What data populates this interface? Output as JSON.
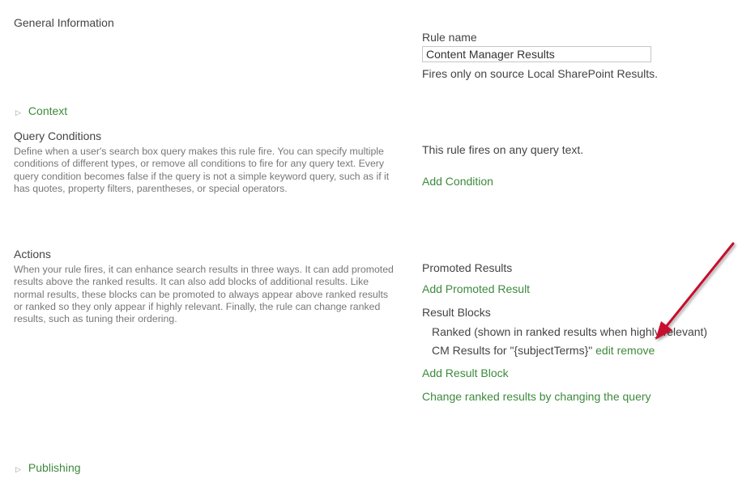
{
  "general": {
    "title": "General Information",
    "rule_name_label": "Rule name",
    "rule_name_value": "Content Manager Results",
    "source_note": "Fires only on source Local SharePoint Results."
  },
  "context": {
    "label": "Context"
  },
  "query_conditions": {
    "title": "Query Conditions",
    "description": "Define when a user's search box query makes this rule fire. You can specify multiple conditions of different types, or remove all conditions to fire for any query text. Every query condition becomes false if the query is not a simple keyword query, such as if it has quotes, property filters, parentheses, or special operators.",
    "status": "This rule fires on any query text.",
    "add_condition": "Add Condition"
  },
  "actions": {
    "title": "Actions",
    "description": "When your rule fires, it can enhance search results in three ways. It can add promoted results above the ranked results. It can also add blocks of additional results. Like normal results, these blocks can be promoted to always appear above ranked results or ranked so they only appear if highly relevant. Finally, the rule can change ranked results, such as tuning their ordering.",
    "promoted_results_label": "Promoted Results",
    "add_promoted_result": "Add Promoted Result",
    "result_blocks_label": "Result Blocks",
    "ranked_note": "Ranked (shown in ranked results when highly relevant)",
    "block_name": "CM Results for \"{subjectTerms}\"",
    "edit_link": "edit",
    "remove_link": "remove",
    "add_result_block": "Add Result Block",
    "change_ranked": "Change ranked results by changing the query"
  },
  "publishing": {
    "label": "Publishing"
  },
  "icons": {
    "expander": "triangle-right-icon",
    "annotation": "arrow-icon"
  },
  "colors": {
    "link": "#3d8a3d",
    "text": "#444444",
    "description": "#777777",
    "annotation_arrow": "#c8102e"
  }
}
